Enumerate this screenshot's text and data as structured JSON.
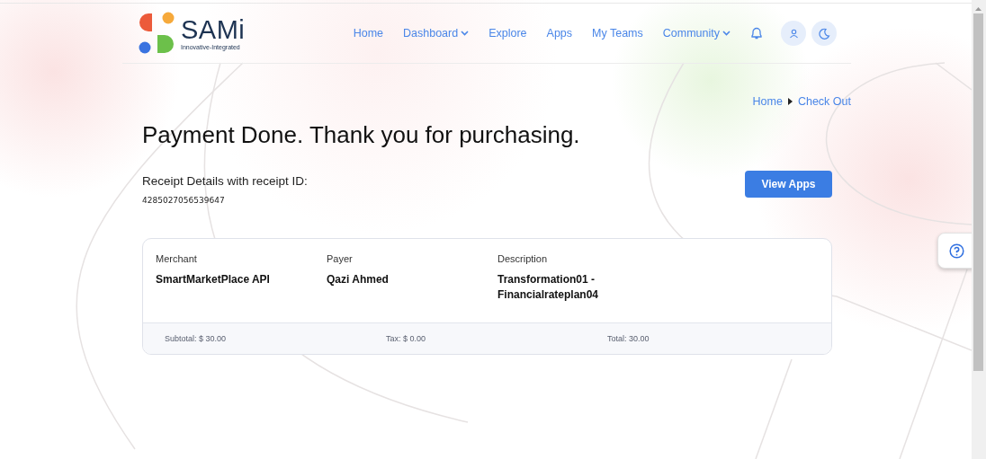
{
  "logo": {
    "name": "SAMi",
    "tagline": "Innovative-Integrated"
  },
  "nav": [
    {
      "label": "Home",
      "dropdown": false
    },
    {
      "label": "Dashboard",
      "dropdown": true
    },
    {
      "label": "Explore",
      "dropdown": false
    },
    {
      "label": "Apps",
      "dropdown": false
    },
    {
      "label": "My Teams",
      "dropdown": false
    },
    {
      "label": "Community",
      "dropdown": true
    }
  ],
  "breadcrumb": [
    "Home",
    "Check Out"
  ],
  "title": "Payment Done. Thank you for purchasing.",
  "receipt": {
    "label": "Receipt Details with receipt ID:",
    "id": "4285027056539647"
  },
  "action_button": "View Apps",
  "details": [
    {
      "label": "Merchant",
      "value": "SmartMarketPlace API"
    },
    {
      "label": "Payer",
      "value": "Qazi Ahmed"
    },
    {
      "label": "Description",
      "value": "Transformation01 - Financialrateplan04"
    }
  ],
  "totals": [
    "Subtotal: $ 30.00",
    "Tax: $ 0.00",
    "Total: 30.00"
  ]
}
